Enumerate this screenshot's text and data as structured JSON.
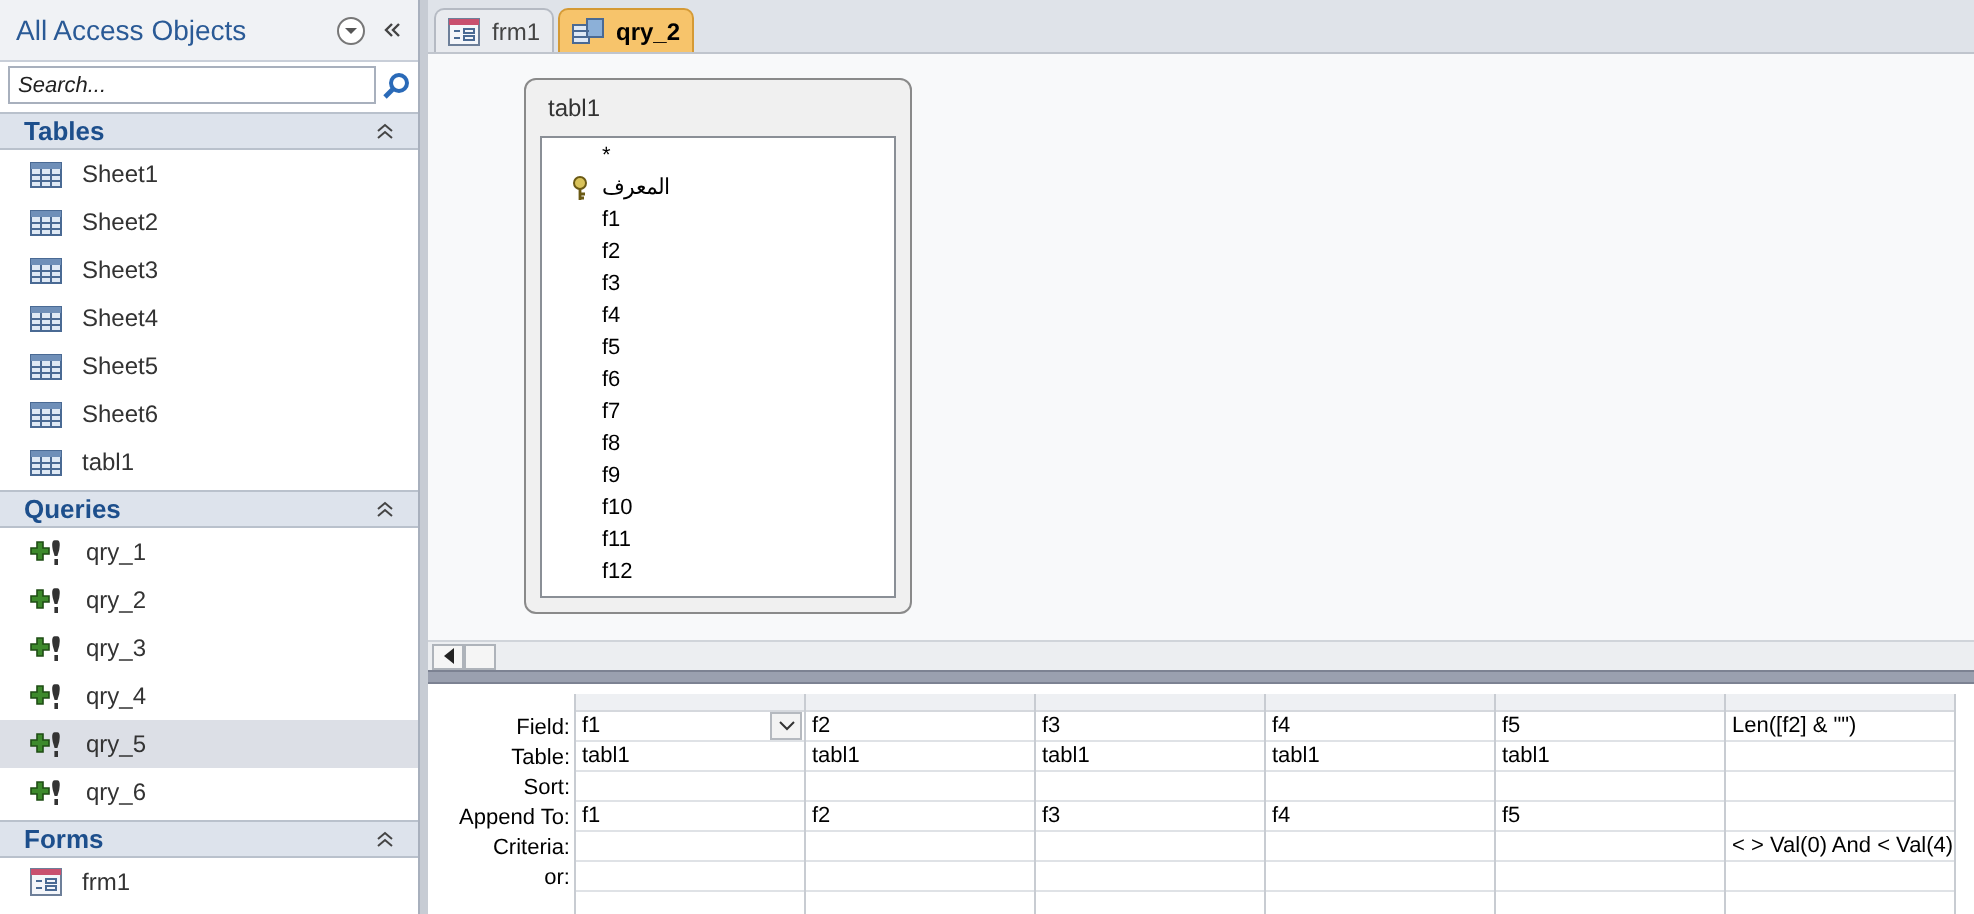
{
  "nav": {
    "title": "All Access Objects",
    "search": {
      "placeholder": "Search..."
    },
    "groups": [
      {
        "title": "Tables",
        "kind": "table",
        "items": [
          {
            "label": "Sheet1",
            "selected": false
          },
          {
            "label": "Sheet2",
            "selected": false
          },
          {
            "label": "Sheet3",
            "selected": false
          },
          {
            "label": "Sheet4",
            "selected": false
          },
          {
            "label": "Sheet5",
            "selected": false
          },
          {
            "label": "Sheet6",
            "selected": false
          },
          {
            "label": "tabl1",
            "selected": false
          }
        ]
      },
      {
        "title": "Queries",
        "kind": "query",
        "items": [
          {
            "label": "qry_1",
            "selected": false
          },
          {
            "label": "qry_2",
            "selected": false
          },
          {
            "label": "qry_3",
            "selected": false
          },
          {
            "label": "qry_4",
            "selected": false
          },
          {
            "label": "qry_5",
            "selected": true
          },
          {
            "label": "qry_6",
            "selected": false
          }
        ]
      },
      {
        "title": "Forms",
        "kind": "form",
        "items": [
          {
            "label": "frm1",
            "selected": false
          }
        ]
      }
    ]
  },
  "tabs": [
    {
      "label": "frm1",
      "kind": "form",
      "selected": false
    },
    {
      "label": "qry_2",
      "kind": "query",
      "selected": true
    }
  ],
  "field_list": {
    "title": "tabl1",
    "fields": [
      {
        "name": "*",
        "primary_key": false
      },
      {
        "name": "المعرف",
        "primary_key": true
      },
      {
        "name": "f1",
        "primary_key": false
      },
      {
        "name": "f2",
        "primary_key": false
      },
      {
        "name": "f3",
        "primary_key": false
      },
      {
        "name": "f4",
        "primary_key": false
      },
      {
        "name": "f5",
        "primary_key": false
      },
      {
        "name": "f6",
        "primary_key": false
      },
      {
        "name": "f7",
        "primary_key": false
      },
      {
        "name": "f8",
        "primary_key": false
      },
      {
        "name": "f9",
        "primary_key": false
      },
      {
        "name": "f10",
        "primary_key": false
      },
      {
        "name": "f11",
        "primary_key": false
      },
      {
        "name": "f12",
        "primary_key": false
      }
    ]
  },
  "grid": {
    "row_labels": [
      "Field:",
      "Table:",
      "Sort:",
      "Append To:",
      "Criteria:",
      "or:"
    ],
    "columns": [
      {
        "field": "f1",
        "table": "tabl1",
        "append_to": "f1",
        "selected": true
      },
      {
        "field": "f2",
        "table": "tabl1",
        "append_to": "f2",
        "selected": false
      },
      {
        "field": "f3",
        "table": "tabl1",
        "append_to": "f3",
        "selected": false
      },
      {
        "field": "f4",
        "table": "tabl1",
        "append_to": "f4",
        "selected": false
      },
      {
        "field": "f5",
        "table": "tabl1",
        "append_to": "f5",
        "selected": false
      },
      {
        "field": "Len([f2] & \"\")",
        "criteria": "< > Val(0) And < Val(4)",
        "selected": false
      }
    ]
  }
}
